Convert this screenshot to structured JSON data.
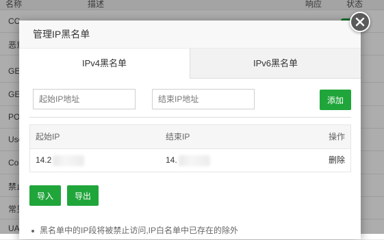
{
  "background": {
    "headers": [
      "名称",
      "描述",
      "响应",
      "状态"
    ],
    "rows": [
      "CC",
      "恶意",
      "GE",
      "GE",
      "PO",
      "Use",
      "Co",
      "禁止",
      "常见",
      "UA"
    ]
  },
  "modal": {
    "title": "管理IP黑名单",
    "tabs": [
      {
        "label": "IPv4黑名单",
        "active": true
      },
      {
        "label": "IPv6黑名单",
        "active": false
      }
    ],
    "start_ip_placeholder": "起始IP地址",
    "end_ip_placeholder": "结束IP地址",
    "add_label": "添加",
    "table": {
      "headers": {
        "start_ip": "起始IP",
        "end_ip": "结束IP",
        "action": "操作"
      },
      "rows": [
        {
          "start_ip": "14.2",
          "end_ip": "14.",
          "action": "删除"
        }
      ]
    },
    "import_label": "导入",
    "export_label": "导出",
    "note": "黑名单中的IP段将被禁止访问,IP白名单中已存在的除外"
  },
  "colors": {
    "accent": "#20a53a",
    "overlay": "rgba(0,0,0,0.32)"
  },
  "icons": {
    "close": "close-icon"
  }
}
